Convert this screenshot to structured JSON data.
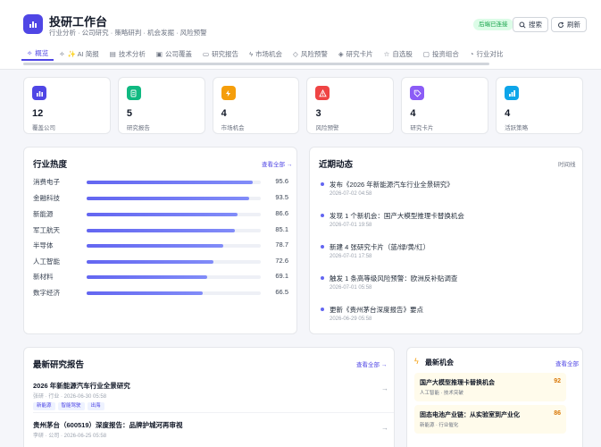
{
  "app": {
    "title": "投研工作台",
    "subtitle": "行业分析 · 公司研究 · 策略研判 · 机会发掘 · 风险预警"
  },
  "header": {
    "connection_badge": "后端已连接",
    "search_label": "搜索",
    "refresh_label": "刷新"
  },
  "tabs": [
    {
      "label": "概览",
      "icon": "sparkle-icon",
      "active": true
    },
    {
      "label": "✨ AI 简报",
      "icon": "sparkle-icon",
      "active": false
    },
    {
      "label": "技术分析",
      "icon": "chart-icon",
      "active": false
    },
    {
      "label": "公司覆盖",
      "icon": "building-icon",
      "active": false
    },
    {
      "label": "研究报告",
      "icon": "document-icon",
      "active": false
    },
    {
      "label": "市场机会",
      "icon": "bolt-icon",
      "active": false
    },
    {
      "label": "风险预警",
      "icon": "shield-icon",
      "active": false
    },
    {
      "label": "研究卡片",
      "icon": "tag-icon",
      "active": false
    },
    {
      "label": "自选股",
      "icon": "star-icon",
      "active": false
    },
    {
      "label": "投资组合",
      "icon": "briefcase-icon",
      "active": false
    },
    {
      "label": "行业对比",
      "icon": "pie-icon",
      "active": false
    }
  ],
  "stats": [
    {
      "value": "12",
      "label": "覆盖公司",
      "icon": "chart-icon",
      "color": "#4f46e5"
    },
    {
      "value": "5",
      "label": "研究报告",
      "icon": "document-icon",
      "color": "#10b981"
    },
    {
      "value": "4",
      "label": "市场机会",
      "icon": "bolt-icon",
      "color": "#f59e0b"
    },
    {
      "value": "3",
      "label": "风险预警",
      "icon": "warning-icon",
      "color": "#ef4444"
    },
    {
      "value": "4",
      "label": "研究卡片",
      "icon": "tag-icon",
      "color": "#8b5cf6"
    },
    {
      "value": "4",
      "label": "活跃策略",
      "icon": "strategy-icon",
      "color": "#0ea5e9"
    }
  ],
  "industry_heat": {
    "title": "行业热度",
    "link": "查看全部 →",
    "items": [
      {
        "name": "消费电子",
        "score": "95.6",
        "value": 95.6
      },
      {
        "name": "金融科技",
        "score": "93.5",
        "value": 93.5
      },
      {
        "name": "新能源",
        "score": "86.6",
        "value": 86.6
      },
      {
        "name": "军工航天",
        "score": "85.1",
        "value": 85.1
      },
      {
        "name": "半导体",
        "score": "78.7",
        "value": 78.7
      },
      {
        "name": "人工智能",
        "score": "72.6",
        "value": 72.6
      },
      {
        "name": "新材料",
        "score": "69.1",
        "value": 69.1
      },
      {
        "name": "数字经济",
        "score": "66.5",
        "value": 66.5
      }
    ]
  },
  "activity": {
    "title": "近期动态",
    "link": "时间线",
    "items": [
      {
        "text": "发布《2026 年新能源汽车行业全景研究》",
        "time": "2026-07-02 04:58"
      },
      {
        "text": "发现 1 个新机会：国产大模型推理卡替换机会",
        "time": "2026-07-01 19:58"
      },
      {
        "text": "新建 4 张研究卡片（蓝/绿/黄/红）",
        "time": "2026-07-01 17:58"
      },
      {
        "text": "触发 1 条高等级风险预警：欧洲反补贴调查",
        "time": "2026-07-01 05:58"
      },
      {
        "text": "更新《贵州茅台深度报告》要点",
        "time": "2026-06-29 05:58"
      }
    ]
  },
  "reports": {
    "title": "最新研究报告",
    "link": "查看全部 →",
    "items": [
      {
        "title": "2026 年新能源汽车行业全景研究",
        "meta": "张研 · 行业 · 2026-06-30 05:58",
        "tags": [
          "新能源",
          "智能驾驶",
          "出海"
        ]
      },
      {
        "title": "贵州茅台（600519）深度报告：品牌护城河再审视",
        "meta": "李研 · 公司 · 2026-06-25 05:58",
        "tags": []
      }
    ]
  },
  "opportunities": {
    "title": "最新机会",
    "link": "查看全部",
    "items": [
      {
        "title": "国产大模型推理卡替换机会",
        "sub": "人工智能 · 技术突破",
        "score": "92"
      },
      {
        "title": "固态电池产业链：从实验室到产业化",
        "sub": "新能源 · 行业催化",
        "score": "86"
      }
    ]
  }
}
